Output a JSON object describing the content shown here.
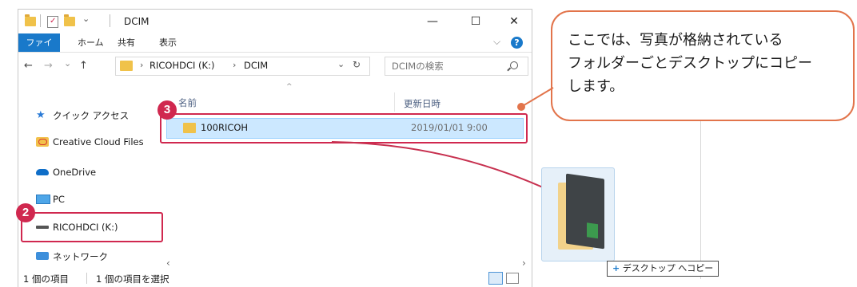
{
  "window": {
    "title": "DCIM",
    "controls": {
      "minimize": "—",
      "maximize": "☐",
      "close": "✕"
    }
  },
  "ribbon": {
    "tabs": [
      "ファイル",
      "ホーム",
      "共有",
      "表示"
    ],
    "expand": "⌵",
    "help": "?"
  },
  "nav": {
    "back": "←",
    "forward": "→",
    "recent": "⌄",
    "up": "↑",
    "address": {
      "drive": "RICOHDCI (K:)",
      "folder": "DCIM",
      "sep": "›"
    },
    "address_dropdown": "⌄",
    "refresh": "↻",
    "search_placeholder": "DCIMの検索"
  },
  "sidebar": {
    "items": [
      {
        "label": "クイック アクセス",
        "icon": "star-icon"
      },
      {
        "label": "Creative Cloud Files",
        "icon": "creative-cloud-icon"
      },
      {
        "label": "OneDrive",
        "icon": "cloud-icon"
      },
      {
        "label": "PC",
        "icon": "monitor-icon"
      },
      {
        "label": "RICOHDCI (K:)",
        "icon": "drive-icon"
      },
      {
        "label": "ネットワーク",
        "icon": "network-icon"
      }
    ]
  },
  "list": {
    "headers": {
      "name": "名前",
      "date": "更新日時"
    },
    "rows": [
      {
        "name": "100RICOH",
        "date": "2019/01/01 9:00"
      }
    ]
  },
  "status": {
    "count": "1 個の項目",
    "selected": "1 個の項目を選択"
  },
  "callout": {
    "lines": [
      "ここでは、写真が格納されている",
      "フォルダーごとデスクトップにコピー",
      "します。"
    ]
  },
  "badges": {
    "drive": "2",
    "folder": "3"
  },
  "drag": {
    "label": "デスクトップ へコピー",
    "plus": "+"
  },
  "colors": {
    "accent": "#1979ca",
    "highlight": "#d0284f",
    "callout_border": "#e2744b",
    "selection": "#cce8ff"
  }
}
